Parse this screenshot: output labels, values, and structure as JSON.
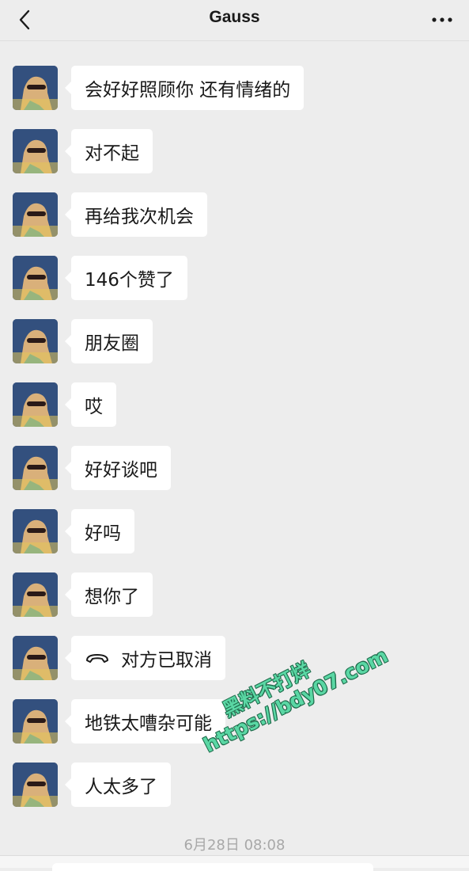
{
  "header": {
    "title": "Gauss",
    "back_icon": "chevron-left-icon",
    "more_icon": "more-dots-icon"
  },
  "messages": [
    {
      "text": "会好好照顾你 还有情绪的"
    },
    {
      "text": "对不起"
    },
    {
      "text": "再给我次机会"
    },
    {
      "text": "146个赞了"
    },
    {
      "text": "朋友圈"
    },
    {
      "text": "哎"
    },
    {
      "text": "好好谈吧"
    },
    {
      "text": "好吗"
    },
    {
      "text": "想你了"
    },
    {
      "text": "对方已取消",
      "icon": "phone-hangup-icon"
    },
    {
      "text": "地铁太嘈杂可能"
    },
    {
      "text": "人太多了"
    }
  ],
  "timestamp": "6月28日 08:08",
  "watermark": {
    "line1": "黑料不打烊",
    "line2": "https://bdy07.com"
  },
  "colors": {
    "background": "#ededed",
    "bubble": "#ffffff",
    "watermark": "#5ad7a4"
  }
}
